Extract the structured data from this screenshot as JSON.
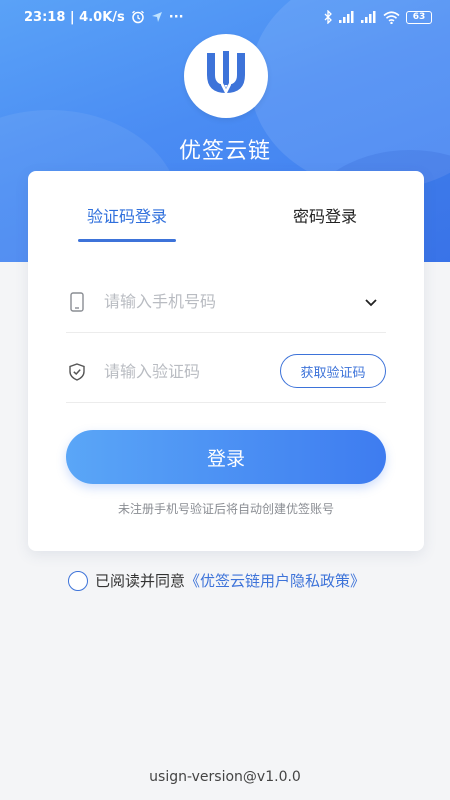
{
  "status_bar": {
    "time_speed": "23:18 | 4.0K/s",
    "more": "···",
    "battery": "63",
    "icons": [
      "alarm-icon",
      "send-icon",
      "bluetooth-icon",
      "signal-icon",
      "hd-signal-icon",
      "wifi-icon",
      "battery-icon"
    ]
  },
  "app": {
    "title": "优签云链",
    "logo_icon": "u-pen-logo"
  },
  "tabs": [
    {
      "label": "验证码登录",
      "active": true
    },
    {
      "label": "密码登录",
      "active": false
    }
  ],
  "phone_field": {
    "placeholder": "请输入手机号码",
    "value": ""
  },
  "code_field": {
    "placeholder": "请输入验证码",
    "value": ""
  },
  "get_code_label": "获取验证码",
  "login_label": "登录",
  "hint": "未注册手机号验证后将自动创建优签账号",
  "agreement": {
    "prefix": "已阅读并同意",
    "link": "《优签云链用户隐私政策》",
    "checked": false
  },
  "version": "usign-version@v1.0.0",
  "colors": {
    "primary": "#3d73d9",
    "hero_start": "#5aa2f7",
    "hero_end": "#3f7cf0",
    "background": "#f4f5f7"
  }
}
